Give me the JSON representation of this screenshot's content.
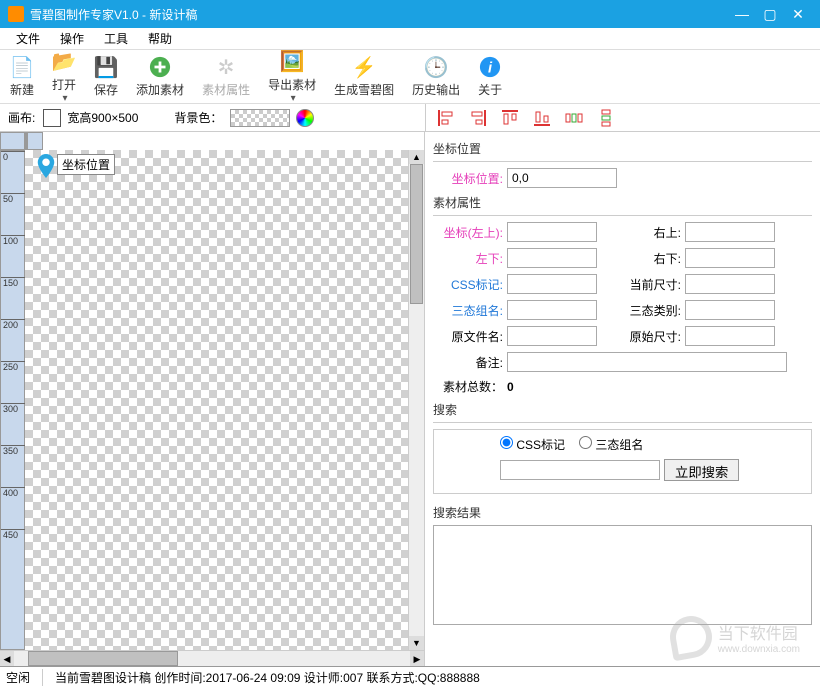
{
  "title": "雪碧图制作专家V1.0 - 新设计稿",
  "menu": {
    "file": "文件",
    "op": "操作",
    "tool": "工具",
    "help": "帮助"
  },
  "toolbar": {
    "new": "新建",
    "open": "打开",
    "save": "保存",
    "addAsset": "添加素材",
    "assetProps": "素材属性",
    "exportAsset": "导出素材",
    "genSprite": "生成雪碧图",
    "history": "历史输出",
    "about": "关于"
  },
  "options": {
    "canvasLabel": "画布:",
    "canvasSize": "宽高900×500",
    "bgLabel": "背景色："
  },
  "canvas": {
    "pinLabel": "坐标位置"
  },
  "rulerTicks": [
    "0",
    "50",
    "100",
    "150",
    "200",
    "250",
    "300",
    "350",
    "400",
    "450"
  ],
  "panels": {
    "posTitle": "坐标位置",
    "posLabel": "坐标位置:",
    "posValue": "0,0",
    "propsTitle": "素材属性",
    "topLeft": "坐标(左上):",
    "topRight": "右上:",
    "bottomLeft": "左下:",
    "bottomRight": "右下:",
    "cssTag": "CSS标记:",
    "curSize": "当前尺寸:",
    "groupName": "三态组名:",
    "groupType": "三态类别:",
    "origFile": "原文件名:",
    "origSize": "原始尺寸:",
    "remark": "备注:",
    "totalLabel": "素材总数：",
    "totalValue": "0",
    "searchTitle": "搜索",
    "searchCss": "CSS标记",
    "searchGroup": "三态组名",
    "searchBtn": "立即搜索",
    "resultTitle": "搜索结果"
  },
  "status": {
    "idle": "空闲",
    "info": "当前雪碧图设计稿 创作时间:2017-06-24 09:09 设计师:007 联系方式:QQ:888888"
  },
  "watermark": {
    "name": "当下软件园",
    "url": "www.downxia.com"
  }
}
